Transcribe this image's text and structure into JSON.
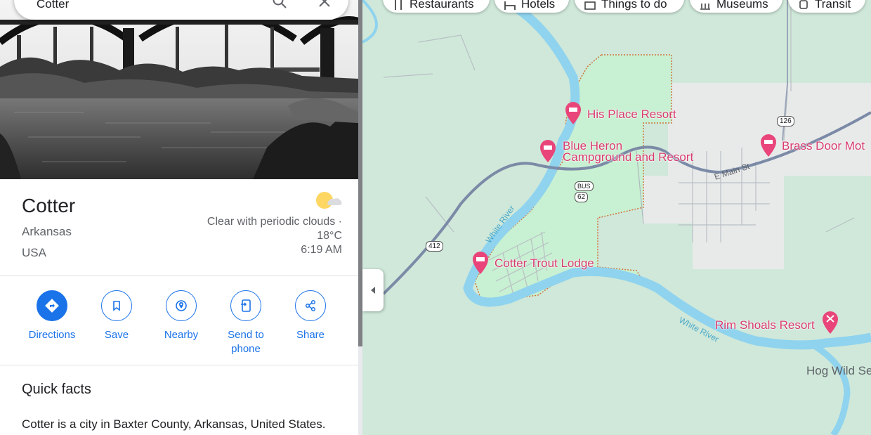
{
  "search": {
    "query": "Cotter"
  },
  "chips": [
    {
      "label": "Restaurants",
      "icon": "fork-knife-icon"
    },
    {
      "label": "Hotels",
      "icon": "bed-icon"
    },
    {
      "label": "Things to do",
      "icon": "camera-icon"
    },
    {
      "label": "Museums",
      "icon": "museum-icon"
    },
    {
      "label": "Transit",
      "icon": "train-icon"
    }
  ],
  "place": {
    "title": "Cotter",
    "state": "Arkansas",
    "country": "USA",
    "weather_desc": "Clear with periodic clouds · 18°C",
    "weather_time": "6:19 AM",
    "weather_icon": "partly-cloudy-icon"
  },
  "actions": [
    {
      "label": "Directions",
      "icon": "directions-icon"
    },
    {
      "label": "Save",
      "icon": "bookmark-icon"
    },
    {
      "label": "Nearby",
      "icon": "nearby-icon"
    },
    {
      "label": "Send to phone",
      "icon": "send-to-phone-icon"
    },
    {
      "label": "Share",
      "icon": "share-icon"
    }
  ],
  "quick_facts": {
    "title": "Quick facts",
    "text": "Cotter is a city in Baxter County, Arkansas, United States."
  },
  "map": {
    "places": [
      {
        "name": "His Place Resort"
      },
      {
        "name": "Blue Heron Campground and Resort",
        "line1": "Blue Heron",
        "line2": "Campground and Resort"
      },
      {
        "name": "Brass Door Mot"
      },
      {
        "name": "Cotter Trout Lodge"
      },
      {
        "name": "Rim Shoals Resort"
      }
    ],
    "other_label": "Hog Wild Se",
    "river_labels": [
      "White River",
      "White River"
    ],
    "street_label": "E Main St",
    "shields": [
      "126",
      "BUS",
      "62",
      "412"
    ]
  },
  "colors": {
    "accent": "#1a73e8",
    "poi": "#d83b6f",
    "river": "#8fd3ee",
    "park": "#c8f0d2",
    "land": "#cfe8da",
    "town": "#e8eaea"
  }
}
